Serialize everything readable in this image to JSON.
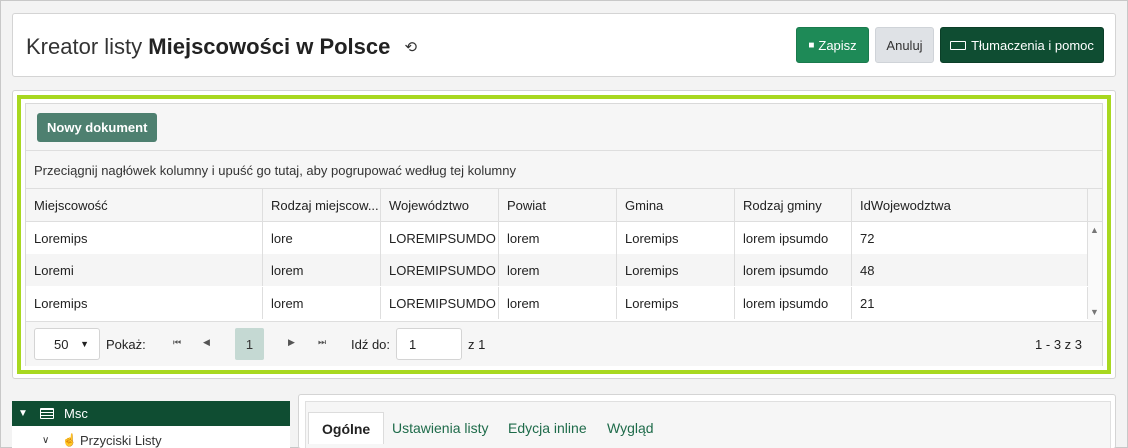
{
  "header": {
    "title_prefix": "Kreator listy",
    "title_name": "Miejscowości w Polsce",
    "save_label": "Zapisz",
    "cancel_label": "Anuluj",
    "help_label": "Tłumaczenia i pomoc"
  },
  "grid": {
    "new_doc_label": "Nowy dokument",
    "group_hint": "Przeciągnij nagłówek kolumny i upuść go tutaj, aby pogrupować według tej kolumny",
    "columns": [
      "Miejscowość",
      "Rodzaj miejscow...",
      "Województwo",
      "Powiat",
      "Gmina",
      "Rodzaj gminy",
      "IdWojewodztwa"
    ],
    "rows": [
      [
        "Loremips",
        "lore",
        "LOREMIPSUMDO",
        "lorem",
        "Loremips",
        "lorem ipsumdo",
        "72"
      ],
      [
        "Loremi",
        "lorem",
        "LOREMIPSUMDO",
        "lorem",
        "Loremips",
        "lorem ipsumdo",
        "48"
      ],
      [
        "Loremips",
        "lorem",
        "LOREMIPSUMDO",
        "lorem",
        "Loremips",
        "lorem ipsumdo",
        "21"
      ]
    ]
  },
  "pager": {
    "page_size": "50",
    "show_label": "Pokaż:",
    "current_page": "1",
    "goto_label": "Idź do:",
    "goto_value": "1",
    "of_label": "z 1",
    "range_label": "1 - 3 z 3"
  },
  "tree": {
    "root_label": "Msc",
    "child_label": "Przyciski Listy"
  },
  "tabs": [
    "Ogólne",
    "Ustawienia listy",
    "Edycja inline",
    "Wygląd"
  ],
  "colors": {
    "save": "#1e8a57",
    "help": "#0f4d32",
    "highlight": "#a8d820",
    "new_doc": "#4e8070"
  }
}
